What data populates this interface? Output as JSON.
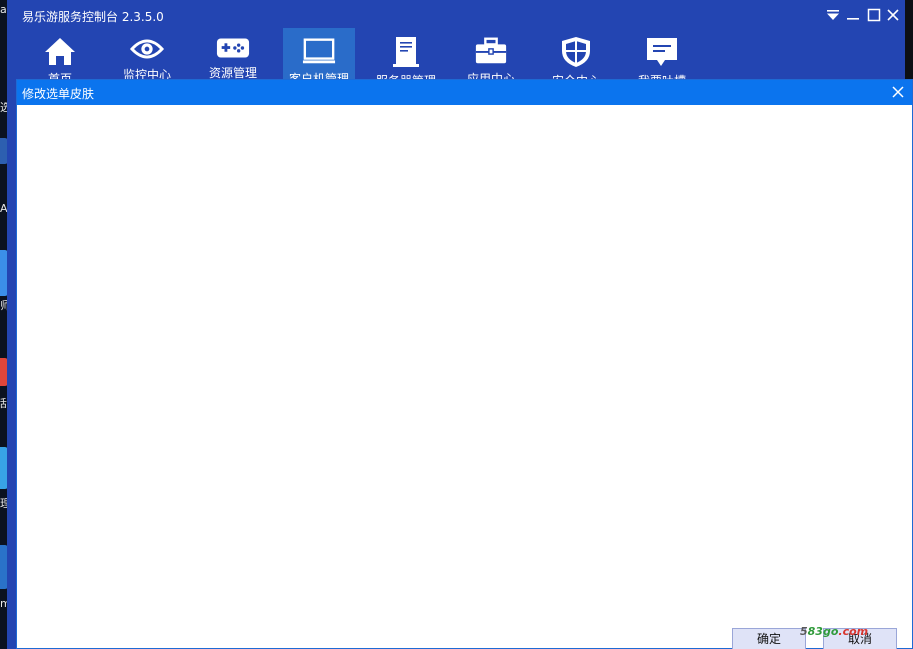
{
  "app": {
    "title": "易乐游服务控制台 2.3.5.0"
  },
  "toolbar": {
    "items": [
      {
        "label": "首页",
        "icon": "home-icon"
      },
      {
        "label": "监控中心",
        "icon": "eye-icon"
      },
      {
        "label": "资源管理",
        "icon": "gamepad-icon"
      },
      {
        "label": "客户机管理",
        "icon": "monitor-icon",
        "active": true
      },
      {
        "label": "服务器管理",
        "icon": "server-icon"
      },
      {
        "label": "应用中心",
        "icon": "toolbox-icon"
      },
      {
        "label": "安全中心",
        "icon": "shield-icon"
      },
      {
        "label": "我要吐槽",
        "icon": "message-icon"
      }
    ]
  },
  "dialog": {
    "title": "修改选单皮肤",
    "ok_label": "确定",
    "cancel_label": "取消"
  },
  "desktop": {
    "fragments": [
      "al",
      "选",
      "Al",
      "师",
      "刮",
      "理",
      "m"
    ]
  },
  "watermark": {
    "part_a": "5",
    "part_b": "83go",
    "part_c": ".com"
  },
  "colors": {
    "window_bg": "#2345b2",
    "active_tool": "#2a6cc9",
    "dialog_title_bg": "#0b74ee",
    "button_bg": "#dfe3f7"
  }
}
